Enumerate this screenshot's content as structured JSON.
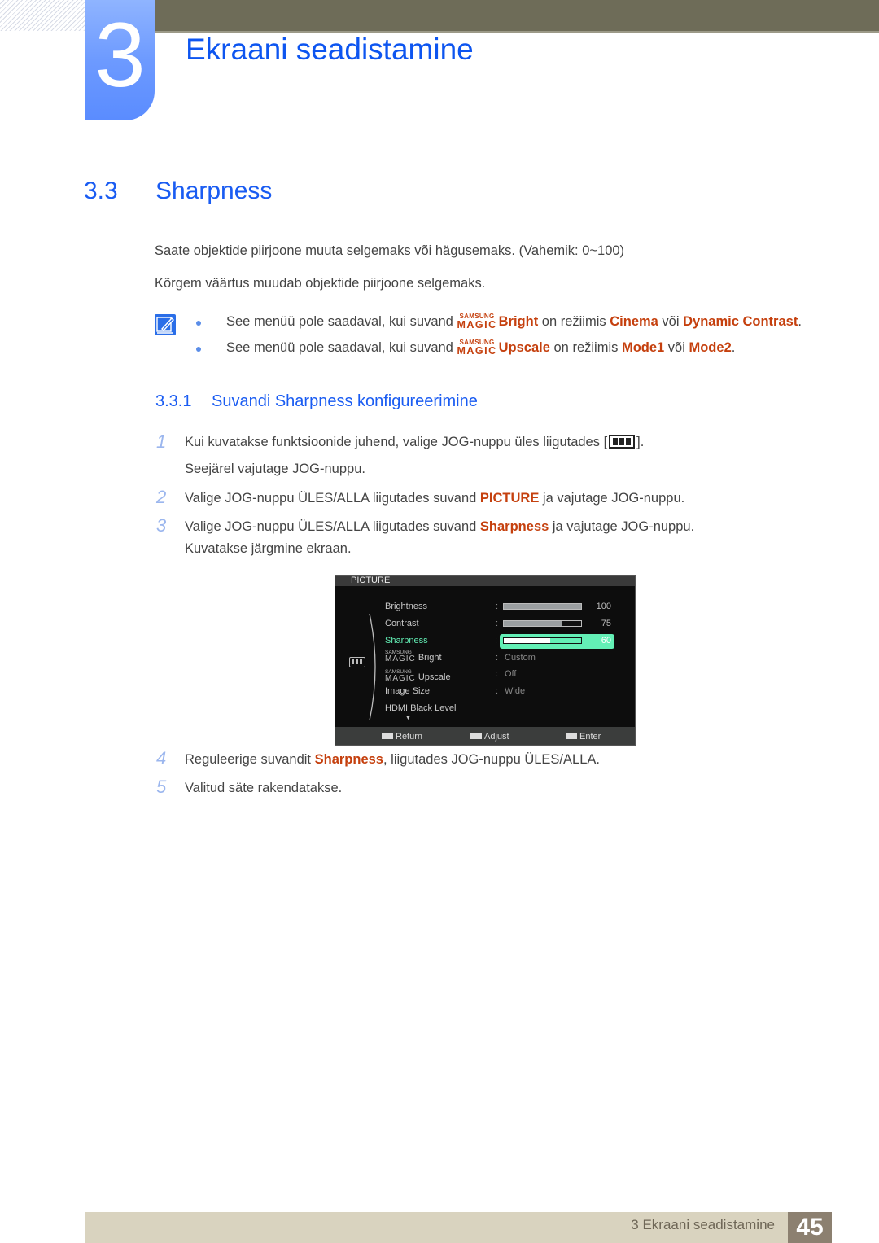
{
  "chapter": {
    "number": "3",
    "title": "Ekraani seadistamine"
  },
  "section": {
    "number": "3.3",
    "title": "Sharpness"
  },
  "intro": [
    "Saate objektide piirjoone muuta selgemaks või hägusemaks. (Vahemik: 0~100)",
    "Kõrgem väärtus muudab objektide piirjoone selgemaks."
  ],
  "notes": [
    {
      "prefix": "See menüü pole saadaval, kui suvand ",
      "magic_top": "SAMSUNG",
      "magic_bottom": "MAGIC",
      "option": "Bright",
      "mid": " on režiimis ",
      "mode1": "Cinema",
      "or": " või ",
      "mode2": "Dynamic Contrast",
      "end": "."
    },
    {
      "prefix": "See menüü pole saadaval, kui suvand ",
      "magic_top": "SAMSUNG",
      "magic_bottom": "MAGIC",
      "option": "Upscale",
      "mid": " on režiimis ",
      "mode1": "Mode1",
      "or": " või ",
      "mode2": "Mode2",
      "end": "."
    }
  ],
  "subsection": {
    "number": "3.3.1",
    "title": "Suvandi Sharpness konfigureerimine"
  },
  "steps": [
    {
      "num": "1",
      "text_a": "Kui kuvatakse funktsioonide juhend, valige JOG-nuppu üles liigutades [",
      "text_b": "].",
      "line2": "Seejärel vajutage JOG-nuppu."
    },
    {
      "num": "2",
      "text_a": "Valige JOG-nuppu ÜLES/ALLA liigutades suvand ",
      "hl": "PICTURE",
      "text_b": " ja vajutage JOG-nuppu."
    },
    {
      "num": "3",
      "text_a": "Valige JOG-nuppu ÜLES/ALLA liigutades suvand ",
      "hl": "Sharpness",
      "text_b": " ja vajutage JOG-nuppu.",
      "line2": "Kuvatakse järgmine ekraan."
    },
    {
      "num": "4",
      "text_a": "Reguleerige suvandit ",
      "hl": "Sharpness",
      "text_b": ", liigutades JOG-nuppu ÜLES/ALLA."
    },
    {
      "num": "5",
      "text_a": "Valitud säte rakendatakse."
    }
  ],
  "osd": {
    "header": "PICTURE",
    "items": [
      {
        "label": "Brightness",
        "value": 100,
        "value_text": "100"
      },
      {
        "label": "Contrast",
        "value": 75,
        "value_text": "75"
      },
      {
        "label": "Sharpness",
        "value": 60,
        "value_text": "60",
        "selected": true
      },
      {
        "magic_top": "SAMSUNG",
        "magic_bottom": "MAGIC",
        "label": "Bright",
        "value_text": "Custom"
      },
      {
        "magic_top": "SAMSUNG",
        "magic_bottom": "MAGIC",
        "label": "Upscale",
        "value_text": "Off"
      },
      {
        "label": "Image Size",
        "value_text": "Wide"
      },
      {
        "label": "HDMI Black Level"
      }
    ],
    "more_indicator": "▼",
    "footer": {
      "return": "Return",
      "adjust": "Adjust",
      "enter": "Enter"
    }
  },
  "footer": {
    "text": "3 Ekraani seadistamine",
    "page": "45"
  }
}
